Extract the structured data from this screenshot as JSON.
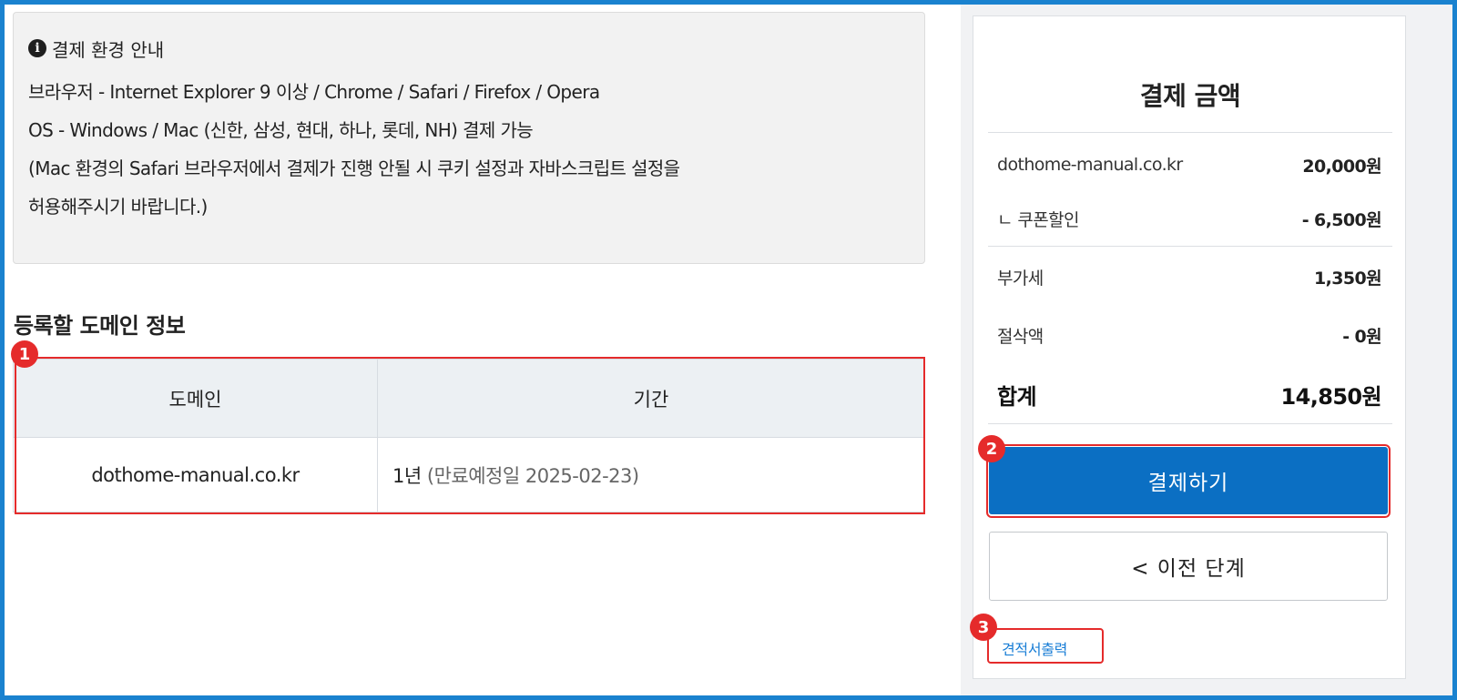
{
  "notice": {
    "title": "결제 환경 안내",
    "icon": "info-icon",
    "lines": [
      "브라우저 - Internet Explorer 9 이상 / Chrome / Safari / Firefox / Opera",
      "OS - Windows / Mac (신한, 삼성, 현대, 하나, 롯데, NH) 결제 가능",
      "(Mac 환경의 Safari 브라우저에서 결제가 진행 안될 시 쿠키 설정과 자바스크립트 설정을",
      "허용해주시기 바랍니다.)"
    ]
  },
  "domain_section": {
    "title": "등록할 도메인 정보",
    "columns": [
      "도메인",
      "기간"
    ],
    "rows": [
      {
        "domain": "dothome-manual.co.kr",
        "period": "1년",
        "expiry": "(만료예정일 2025-02-23)"
      }
    ]
  },
  "summary": {
    "title": "결제 금액",
    "items": [
      {
        "label": "dothome-manual.co.kr",
        "value": "20,000원"
      },
      {
        "label": "ㄴ 쿠폰할인",
        "value": "- 6,500원"
      },
      {
        "label": "부가세",
        "value": "1,350원"
      },
      {
        "label": "절삭액",
        "value": "- 0원"
      }
    ],
    "total": {
      "label": "합계",
      "value": "14,850원"
    },
    "pay_button": "결제하기",
    "prev_button": "< 이전 단계",
    "quote_link": "견적서출력"
  },
  "annotations": [
    "1",
    "2",
    "3"
  ],
  "colors": {
    "frame": "#1a82cf",
    "primary": "#0b6fc3",
    "annotation": "#e52b2b",
    "link": "#1a7ed6"
  }
}
